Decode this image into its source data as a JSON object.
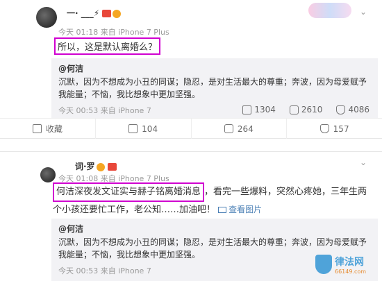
{
  "post1": {
    "username": "一· ___⚡",
    "meta": "今天 01:18 来自 iPhone 7 Plus",
    "text": "所以，这是默认离婚么？",
    "quote": {
      "user": "@何洁",
      "text": "沉默，因为不想成为小丑的同谋；隐忍，是对生活最大的尊重；奔波，因为母爱赋予我能量；不恼，我比想象中更加坚强。",
      "meta": "今天 00:53 来自 iPhone 7",
      "reposts": "1304",
      "comments": "2610",
      "likes": "4086"
    },
    "actions": {
      "collect": "收藏",
      "repost": "104",
      "comment": "264",
      "like": "157"
    }
  },
  "post2": {
    "username": "　词·罗",
    "meta": "今天 01:08 来自 iPhone 7 Plus",
    "text_hl": "何洁深夜发文证实与赫子铭离婚消息",
    "text_rest": "，看完一些爆料，突然心疼她，三年生两",
    "text_line2": "个小孩还要忙工作，老公知……加油吧！",
    "view_pic": "查看图片",
    "quote": {
      "user": "@何洁",
      "text": "沉默，因为不想成为小丑的同谋；隐忍，是对生活最大的尊重；奔波，因为母爱赋予我能量；不恼，我比想象中更加坚强。",
      "meta": "今天 00:53 来自 iPhone 7"
    }
  },
  "watermark": {
    "name": "律法网",
    "site": "66149.com"
  },
  "colors": {
    "highlight": "#d000d0",
    "link": "#4a7fb5",
    "watermark": "#4fa3d9"
  },
  "icons": [
    "repost-icon",
    "comment-icon",
    "like-icon",
    "collect-icon",
    "chevron-down-icon",
    "picture-icon"
  ]
}
